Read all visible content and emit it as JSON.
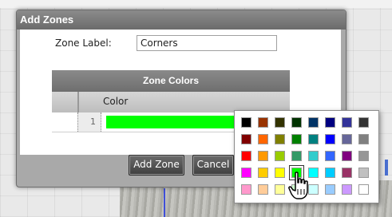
{
  "dialog": {
    "title": "Add Zones",
    "zone_label": "Zone Label:",
    "zone_label_value": "Corners",
    "table": {
      "title": "Zone Colors",
      "column": "Color",
      "rows": [
        {
          "index": "1",
          "color": "#00ff00"
        }
      ]
    },
    "buttons": {
      "add_zone": "Add Zone",
      "cancel": "Cancel"
    }
  },
  "color_picker": {
    "rows": [
      [
        "#000000",
        "#993300",
        "#333300",
        "#003300",
        "#003366",
        "#000080",
        "#333399",
        "#333333"
      ],
      [
        "#800000",
        "#ff6600",
        "#808000",
        "#008000",
        "#008080",
        "#0000ff",
        "#666699",
        "#808080"
      ],
      [
        "#ff0000",
        "#ff9900",
        "#99cc00",
        "#339966",
        "#33cccc",
        "#3366ff",
        "#800080",
        "#969696"
      ],
      [
        "#ff00ff",
        "#ffcc00",
        "#ffff00",
        "#00ff00",
        "#00ffff",
        "#00ccff",
        "#993366",
        "#c0c0c0"
      ],
      [
        "#ff99cc",
        "#ffcc99",
        "#ffff99",
        "#ccffcc",
        "#ccffff",
        "#99ccff",
        "#cc99ff",
        "#ffffff"
      ]
    ],
    "selected": {
      "row": 3,
      "col": 3
    }
  },
  "cursor": "hand-pointer-icon"
}
